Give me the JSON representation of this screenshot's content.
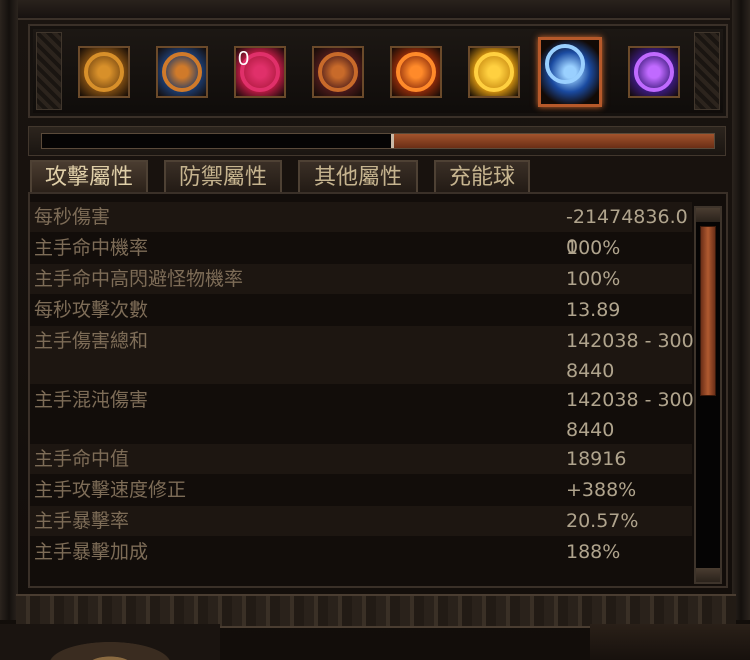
{
  "flasks": [
    {
      "icon": "hydra-flask-icon",
      "colors": [
        "#7a4a12",
        "#d8902a"
      ],
      "label": ""
    },
    {
      "icon": "blue-claw-flask-icon",
      "colors": [
        "#1d3a6a",
        "#d07a2a"
      ],
      "label": ""
    },
    {
      "icon": "red-lungs-flask-icon",
      "colors": [
        "#b01a40",
        "#e0306a"
      ],
      "label": "0"
    },
    {
      "icon": "dark-claw-flask-icon",
      "colors": [
        "#4a1a1a",
        "#c86a2a"
      ],
      "label": ""
    },
    {
      "icon": "fire-rune-flask-icon",
      "colors": [
        "#8a2a0a",
        "#ff8a2a"
      ],
      "label": ""
    },
    {
      "icon": "golden-totem-flask-icon",
      "colors": [
        "#c88a10",
        "#ffd040"
      ],
      "label": ""
    },
    {
      "icon": "lightning-skill-icon",
      "colors": [
        "#1a4aa0",
        "#9ad0ff"
      ],
      "label": "",
      "selected": true
    },
    {
      "icon": "purple-claw-flask-icon",
      "colors": [
        "#3a1a7a",
        "#c06aff"
      ],
      "label": ""
    }
  ],
  "progress": {
    "value": 0.48
  },
  "tabs": [
    {
      "label": "攻擊屬性",
      "active": true
    },
    {
      "label": "防禦屬性"
    },
    {
      "label": "其他屬性"
    },
    {
      "label": "充能球"
    }
  ],
  "stats": [
    {
      "name": "每秒傷害",
      "value": "-21474836.00"
    },
    {
      "name": "主手命中機率",
      "value": "100%"
    },
    {
      "name": "主手命中高閃避怪物機率",
      "value": "100%"
    },
    {
      "name": "每秒攻擊次數",
      "value": "13.89"
    },
    {
      "name": "主手傷害總和",
      "value": "142038 - 3008440"
    },
    {
      "name": "主手混沌傷害",
      "value": "142038 - 3008440"
    },
    {
      "name": "主手命中值",
      "value": "18916"
    },
    {
      "name": "主手攻擊速度修正",
      "value": "+388%"
    },
    {
      "name": "主手暴擊率",
      "value": "20.57%"
    },
    {
      "name": "主手暴擊加成",
      "value": "188%"
    }
  ],
  "scrollbar": {
    "position": 0.0,
    "visible_fraction": 0.45
  }
}
